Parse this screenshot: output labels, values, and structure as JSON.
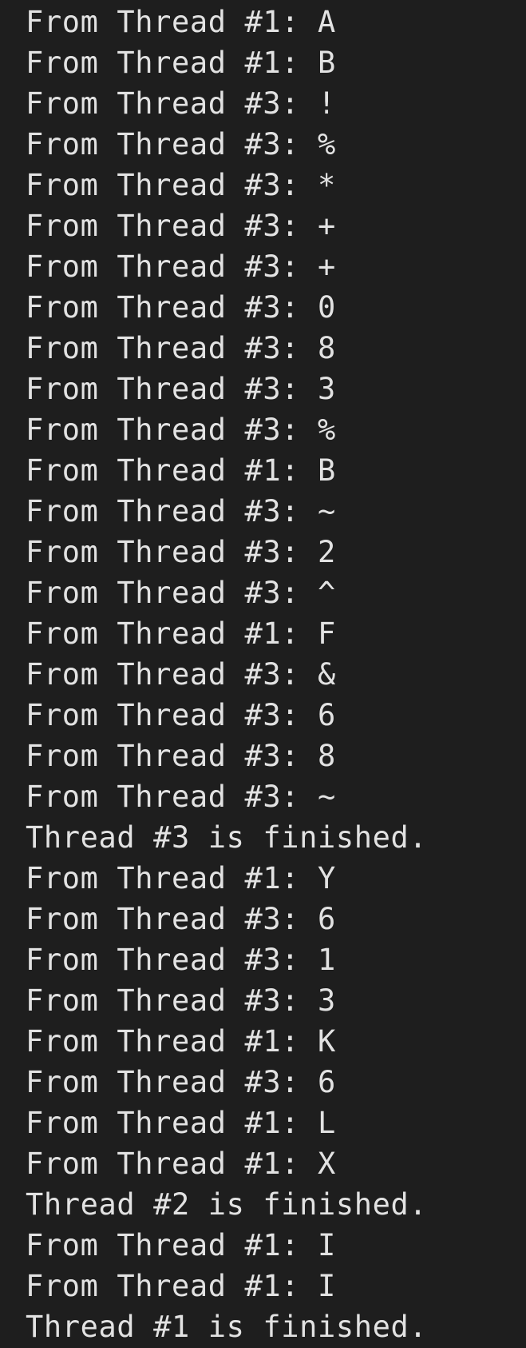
{
  "terminal": {
    "lines": [
      "From Thread #1: A",
      "From Thread #1: B",
      "From Thread #3: !",
      "From Thread #3: %",
      "From Thread #3: *",
      "From Thread #3: +",
      "From Thread #3: +",
      "From Thread #3: 0",
      "From Thread #3: 8",
      "From Thread #3: 3",
      "From Thread #3: %",
      "From Thread #1: B",
      "From Thread #3: ~",
      "From Thread #3: 2",
      "From Thread #3: ^",
      "From Thread #1: F",
      "From Thread #3: &",
      "From Thread #3: 6",
      "From Thread #3: 8",
      "From Thread #3: ~",
      "Thread #3 is finished.",
      "From Thread #1: Y",
      "From Thread #3: 6",
      "From Thread #3: 1",
      "From Thread #3: 3",
      "From Thread #1: K",
      "From Thread #3: 6",
      "From Thread #1: L",
      "From Thread #1: X",
      "Thread #2 is finished.",
      "From Thread #1: I",
      "From Thread #1: I",
      "Thread #1 is finished."
    ]
  }
}
